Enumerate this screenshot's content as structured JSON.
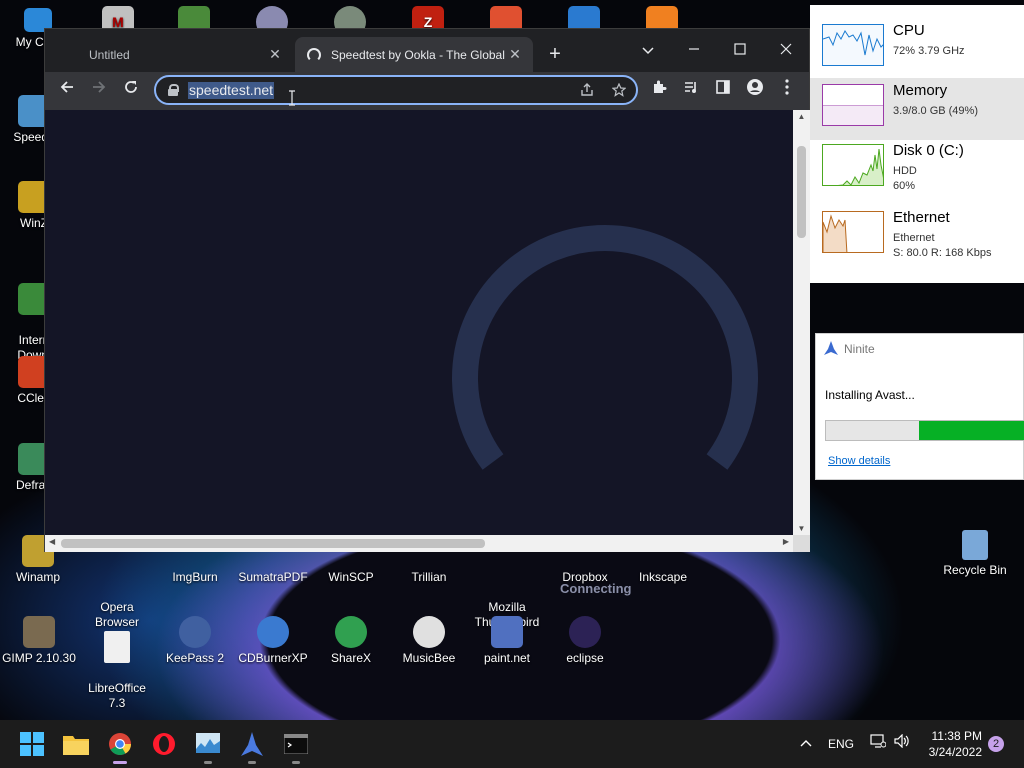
{
  "desktop": {
    "icons": [
      {
        "label": "My Com",
        "icon": "computer-icon",
        "color": "#2b88d8"
      },
      {
        "label": "Speed I",
        "icon": "speed-icon",
        "color": "#4a90c8"
      },
      {
        "label": "WinZ",
        "icon": "winzip-icon",
        "color": "#c8a020"
      },
      {
        "label": "Intern\nDownl",
        "icon": "idm-icon",
        "color": "#3a8a3a"
      },
      {
        "label": "CClea",
        "icon": "ccleaner-icon",
        "color": "#d04020"
      },
      {
        "label": "Defrag",
        "icon": "defrag-icon",
        "color": "#3a8a5a"
      },
      {
        "label": "Winamp",
        "icon": "winamp-icon",
        "color": "#c0a030"
      },
      {
        "label": "Opera\nBrowser",
        "icon": "opera-icon",
        "color": "#d01020"
      },
      {
        "label": "ImgBurn",
        "icon": "imgburn-icon",
        "color": "#c08020"
      },
      {
        "label": "SumatraPDF",
        "icon": "sumatrapdf-icon",
        "color": "#e0c020"
      },
      {
        "label": "WinSCP",
        "icon": "winscp-icon",
        "color": "#3a6ab0"
      },
      {
        "label": "Trillian",
        "icon": "trillian-icon",
        "color": "#4a8a4a"
      },
      {
        "label": "Mozilla\nThunderbird",
        "icon": "thunderbird-icon",
        "color": "#3a6ac8"
      },
      {
        "label": "Dropbox",
        "icon": "dropbox-icon",
        "color": "#2060d0"
      },
      {
        "label": "Inkscape",
        "icon": "inkscape-icon",
        "color": "#444"
      },
      {
        "label": "Recycle Bin",
        "icon": "recycle-bin-icon",
        "color": "#7aa8d8"
      },
      {
        "label": "GIMP 2.10.30",
        "icon": "gimp-icon",
        "color": "#7a6a50"
      },
      {
        "label": "LibreOffice\n7.3",
        "icon": "libreoffice-icon",
        "color": "#f0f0f0"
      },
      {
        "label": "KeePass 2",
        "icon": "keepass-icon",
        "color": "#4060a0"
      },
      {
        "label": "CDBurnerXP",
        "icon": "cdburnerxp-icon",
        "color": "#3a7ad0"
      },
      {
        "label": "ShareX",
        "icon": "sharex-icon",
        "color": "#30a050"
      },
      {
        "label": "MusicBee",
        "icon": "musicbee-icon",
        "color": "#e0e0e0"
      },
      {
        "label": "paint.net",
        "icon": "paintnet-icon",
        "color": "#5070c0"
      },
      {
        "label": "eclipse",
        "icon": "eclipse-icon",
        "color": "#2c2255"
      }
    ],
    "top_row_icons": [
      {
        "icon": "malwarebytes-icon",
        "color": "#c0c0c0",
        "glyph": "M"
      },
      {
        "icon": "tree-icon",
        "color": "#4a8a3a",
        "glyph": ""
      },
      {
        "icon": "bluetooth-globe-icon",
        "color": "#8a8ab0",
        "glyph": ""
      },
      {
        "icon": "rufus-icon",
        "color": "#7a8a7a",
        "glyph": ""
      },
      {
        "icon": "filezilla-icon",
        "color": "#c02010",
        "glyph": "Z"
      },
      {
        "icon": "greenshot-icon",
        "color": "#e05030",
        "glyph": ""
      },
      {
        "icon": "vscode-icon",
        "color": "#2a7ad0",
        "glyph": ""
      },
      {
        "icon": "vlc-player-icon",
        "color": "#f08020",
        "glyph": ""
      }
    ]
  },
  "browser": {
    "tabs": [
      {
        "title": "Untitled",
        "close": "✕"
      },
      {
        "title": "Speedtest by Ookla - The Global",
        "close": "✕"
      }
    ],
    "new_tab": "+",
    "url": "speedtest.net",
    "page": {
      "status_text": "Connecting"
    }
  },
  "task_manager": {
    "rows": [
      {
        "title": "CPU",
        "sub1": "72%  3.79 GHz",
        "sub2": "",
        "color": "#1a7ad0"
      },
      {
        "title": "Memory",
        "sub1": "3.9/8.0 GB (49%)",
        "sub2": "",
        "color": "#9a3aa8"
      },
      {
        "title": "Disk 0 (C:)",
        "sub1": "HDD",
        "sub2": "60%",
        "color": "#4ca820"
      },
      {
        "title": "Ethernet",
        "sub1": "Ethernet",
        "sub2": "S: 80.0  R: 168 Kbps",
        "color": "#b86a20"
      }
    ]
  },
  "ninite": {
    "title": "Ninite",
    "status": "Installing Avast...",
    "progress_fraction_start": 0.47,
    "show_details": "Show details"
  },
  "taskbar": {
    "apps": [
      {
        "icon": "start-icon"
      },
      {
        "icon": "file-explorer-icon"
      },
      {
        "icon": "chrome-icon",
        "active": true
      },
      {
        "icon": "opera-icon"
      },
      {
        "icon": "task-manager-icon"
      },
      {
        "icon": "ninite-icon"
      },
      {
        "icon": "terminal-icon"
      }
    ],
    "lang": "ENG",
    "time": "11:38 PM",
    "date": "3/24/2022",
    "notifications": "2"
  }
}
